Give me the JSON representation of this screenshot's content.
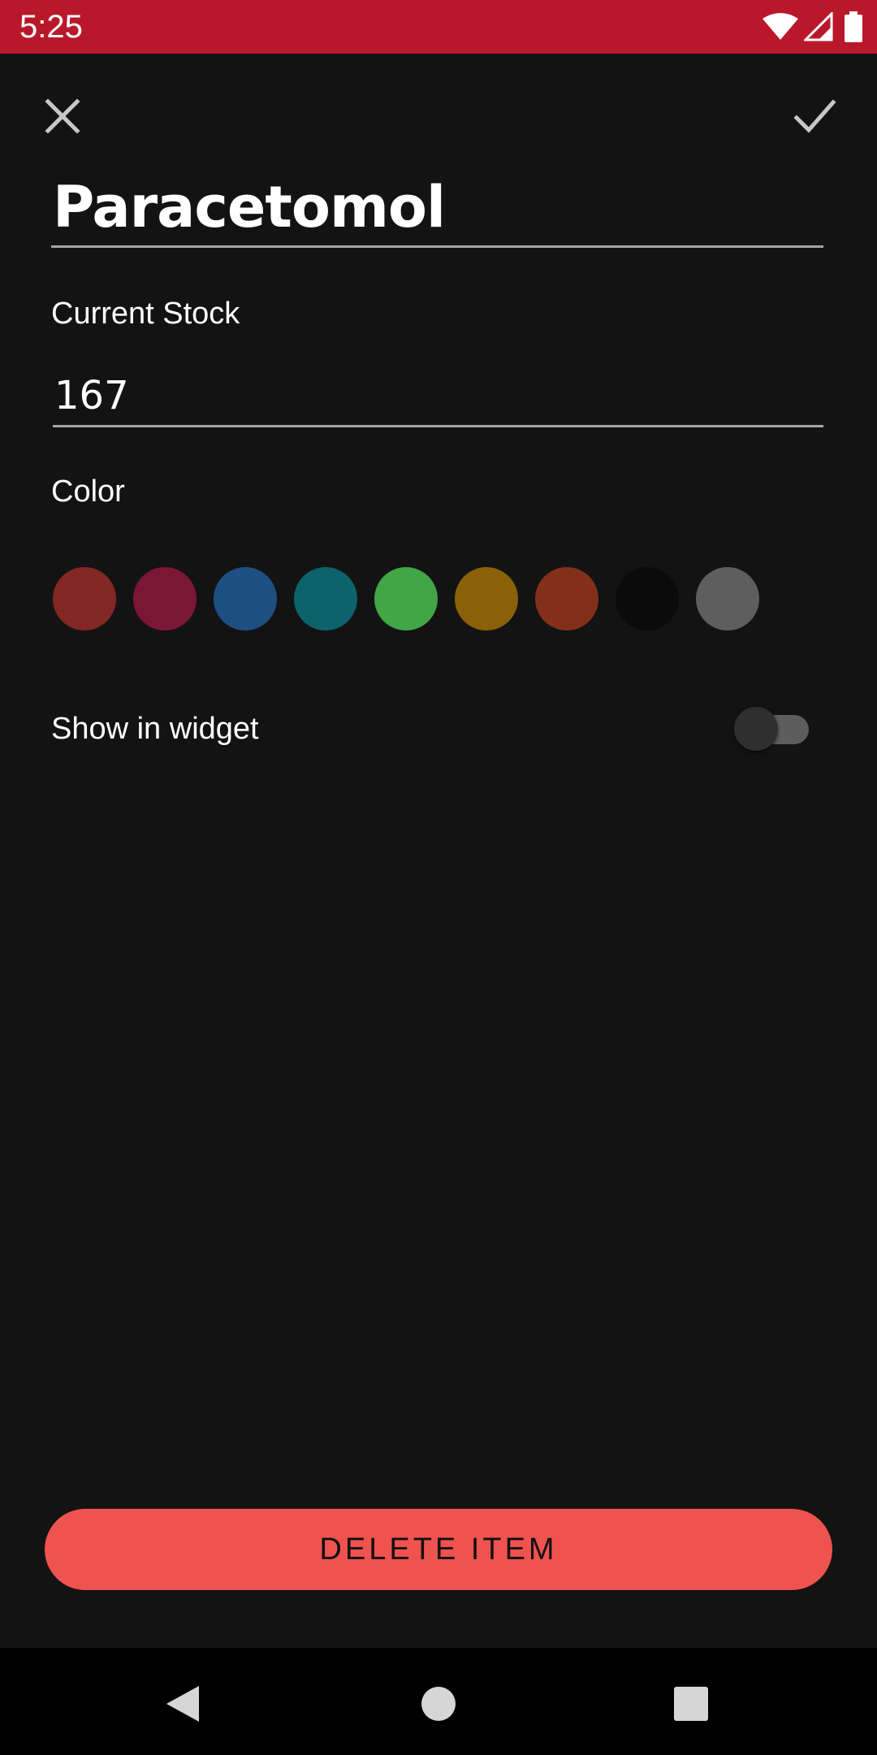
{
  "status_bar": {
    "time": "5:25",
    "background": "#b9182b",
    "icons": [
      "wifi-icon",
      "cellular-signal-icon",
      "battery-icon"
    ]
  },
  "toolbar": {
    "close_icon": "close-icon",
    "save_icon": "check-icon"
  },
  "item": {
    "name": "Paracetomol"
  },
  "stock": {
    "label": "Current Stock",
    "value": "167"
  },
  "color": {
    "label": "Color",
    "swatches": [
      {
        "name": "red",
        "hex": "#822723"
      },
      {
        "name": "crimson",
        "hex": "#7c1637"
      },
      {
        "name": "blue",
        "hex": "#1e4f83"
      },
      {
        "name": "teal",
        "hex": "#0d626b"
      },
      {
        "name": "green",
        "hex": "#42a546"
      },
      {
        "name": "amber",
        "hex": "#8a6109"
      },
      {
        "name": "rust",
        "hex": "#83301a"
      },
      {
        "name": "black",
        "hex": "#0b0b0b"
      },
      {
        "name": "gray",
        "hex": "#5e5e5e"
      }
    ]
  },
  "widget": {
    "label": "Show in widget",
    "enabled": false
  },
  "delete_button": {
    "label": "DELETE ITEM",
    "color": "#ef534f"
  },
  "nav_bar": {
    "icons": [
      "back-icon",
      "home-icon",
      "recents-icon"
    ]
  }
}
